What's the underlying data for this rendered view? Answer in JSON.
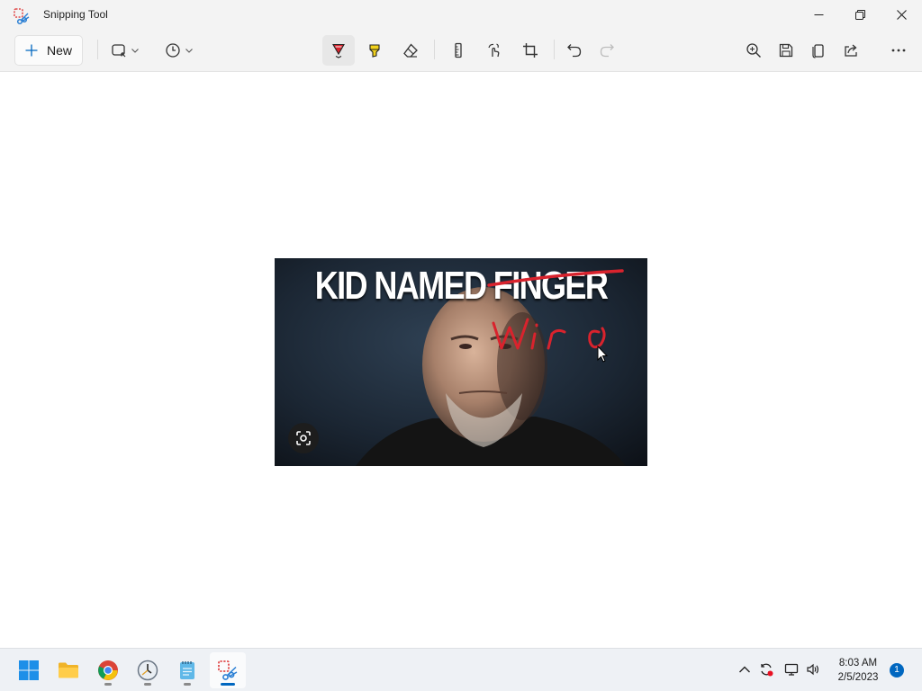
{
  "window": {
    "title": "Snipping Tool"
  },
  "toolbar": {
    "new_label": "New",
    "tools": [
      {
        "name": "snip-mode",
        "icon": "rectangle-snip-icon"
      },
      {
        "name": "delay",
        "icon": "clock-icon"
      },
      {
        "name": "ballpoint-pen",
        "icon": "pen-icon",
        "active": true
      },
      {
        "name": "highlighter",
        "icon": "highlighter-icon"
      },
      {
        "name": "eraser",
        "icon": "eraser-icon"
      },
      {
        "name": "ruler",
        "icon": "ruler-icon"
      },
      {
        "name": "touch-writing",
        "icon": "touch-writing-icon"
      },
      {
        "name": "crop",
        "icon": "crop-icon"
      },
      {
        "name": "undo",
        "icon": "undo-icon"
      },
      {
        "name": "redo",
        "icon": "redo-icon",
        "disabled": true
      },
      {
        "name": "zoom",
        "icon": "zoom-in-icon"
      },
      {
        "name": "save",
        "icon": "save-icon"
      },
      {
        "name": "copy",
        "icon": "copy-icon"
      },
      {
        "name": "share",
        "icon": "share-icon"
      },
      {
        "name": "more",
        "icon": "more-icon"
      }
    ]
  },
  "snip": {
    "headline": "KID NAMED FINGER",
    "handwriting": "Wiro"
  },
  "taskbar": {
    "apps": [
      {
        "name": "start",
        "icon": "windows-logo-icon"
      },
      {
        "name": "file-explorer",
        "icon": "folder-icon"
      },
      {
        "name": "chrome",
        "icon": "chrome-icon"
      },
      {
        "name": "clock",
        "icon": "clock-app-icon"
      },
      {
        "name": "notepad",
        "icon": "notepad-icon"
      },
      {
        "name": "snipping-tool",
        "icon": "snipping-tool-icon",
        "active": true
      }
    ],
    "time": "8:03 AM",
    "date": "2/5/2023",
    "notification_count": "1"
  },
  "colors": {
    "accent": "#0067c0",
    "pen_ink": "#d9232d",
    "highlighter": "#f2d21b"
  }
}
